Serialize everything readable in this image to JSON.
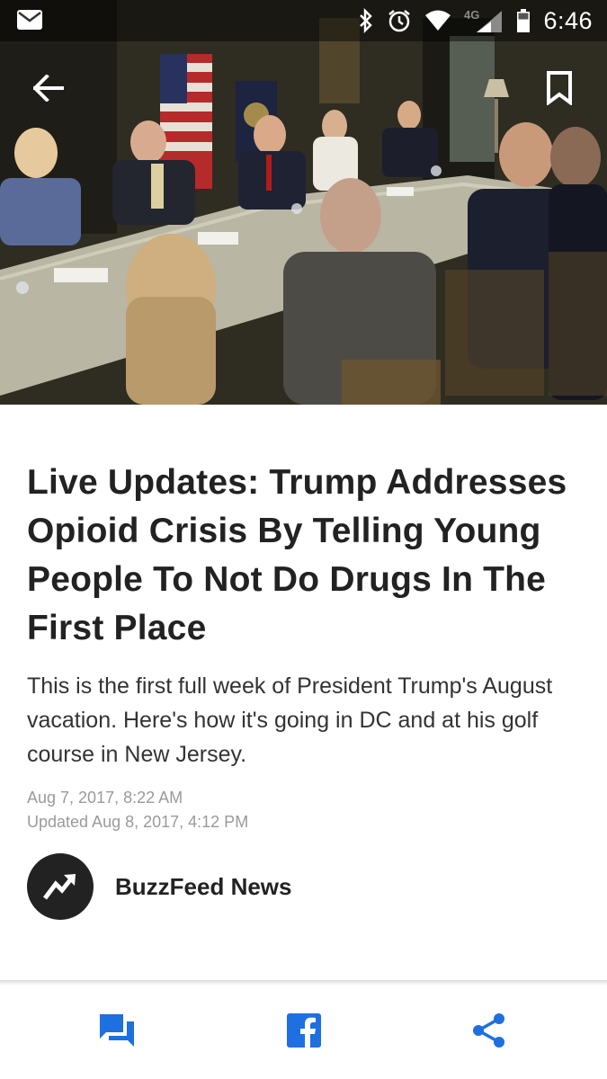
{
  "status_bar": {
    "time": "6:46",
    "network": "4G",
    "icons": [
      "mail-icon",
      "bluetooth-icon",
      "alarm-icon",
      "wifi-icon",
      "signal-icon",
      "battery-icon"
    ]
  },
  "app_bar": {
    "back_icon": "arrow-back-icon",
    "bookmark_icon": "bookmark-icon"
  },
  "article": {
    "headline": "Live Updates: Trump Addresses Opioid Crisis By Telling Young People To Not Do Drugs In The First Place",
    "dek": "This is the first full week of President Trump's August vacation. Here's how it's going in DC and at his golf course in New Jersey.",
    "published": "Aug 7, 2017, 8:22 AM",
    "updated": "Updated Aug 8, 2017, 4:12 PM",
    "author": "BuzzFeed News"
  },
  "action_bar": {
    "comments_icon": "comments-icon",
    "facebook_icon": "facebook-icon",
    "share_icon": "share-icon"
  },
  "colors": {
    "accent": "#1e6fe0",
    "headline": "#222222",
    "meta": "#9a9a9a",
    "avatar": "#222222"
  }
}
